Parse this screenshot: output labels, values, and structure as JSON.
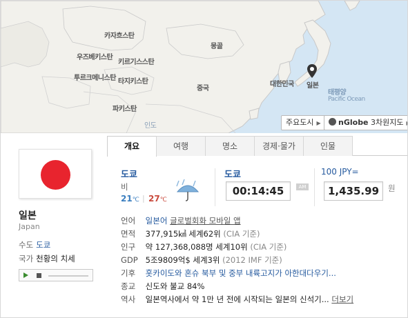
{
  "map": {
    "labels": {
      "kazakhstan": "카자흐스탄",
      "uzbekistan": "우즈베키스탄",
      "kyrgyzstan": "키르기스스탄",
      "turkmenistan": "투르크메니스탄",
      "tajikistan": "타지키스탄",
      "mongolia": "몽골",
      "china": "중국",
      "pakistan": "파키스탄",
      "india": "인도",
      "korea": "대한민국",
      "japan": "일본",
      "pacific_ko": "태평양",
      "pacific_en": "Pacific Ocean"
    },
    "buttons": {
      "major_cities": "주요도시",
      "nglobe_prefix": "nGlobe",
      "nglobe_suffix": "3차원지도"
    }
  },
  "country": {
    "name": "일본",
    "name_en": "Japan",
    "capital_label": "수도",
    "capital_value": "도쿄",
    "anthem_label": "국가",
    "anthem_value": "천황의 치세"
  },
  "tabs": [
    "개요",
    "여행",
    "명소",
    "경제·물가",
    "인물"
  ],
  "weather": {
    "city": "도쿄",
    "desc": "비",
    "low": "21",
    "high": "27",
    "unit": "℃"
  },
  "time": {
    "city": "도쿄",
    "value": "00:14:45",
    "ampm": "AM"
  },
  "currency": {
    "label": "100 JPY=",
    "value": "1,435.99",
    "unit": "원"
  },
  "info": [
    {
      "key": "언어",
      "value": "일본어",
      "extra": "글로벌회화 모바일 앱"
    },
    {
      "key": "면적",
      "value": "377,915㎢ 세계62위",
      "note": "(CIA 기준)"
    },
    {
      "key": "인구",
      "value": "약 127,368,088명 세계10위",
      "note": "(CIA 기준)"
    },
    {
      "key": "GDP",
      "value": "5조9809억$ 세계3위",
      "note": "(2012 IMF 기준)"
    },
    {
      "key": "기후",
      "value": "홋카이도와 혼슈 북부 및 중부 내륙고지가 아한대다우기..."
    },
    {
      "key": "종교",
      "value": "신도와 불교 84%"
    },
    {
      "key": "역사",
      "value": "일본역사에서 약 1만 년 전에 시작되는 일본의 신석기...",
      "more": "더보기"
    }
  ]
}
